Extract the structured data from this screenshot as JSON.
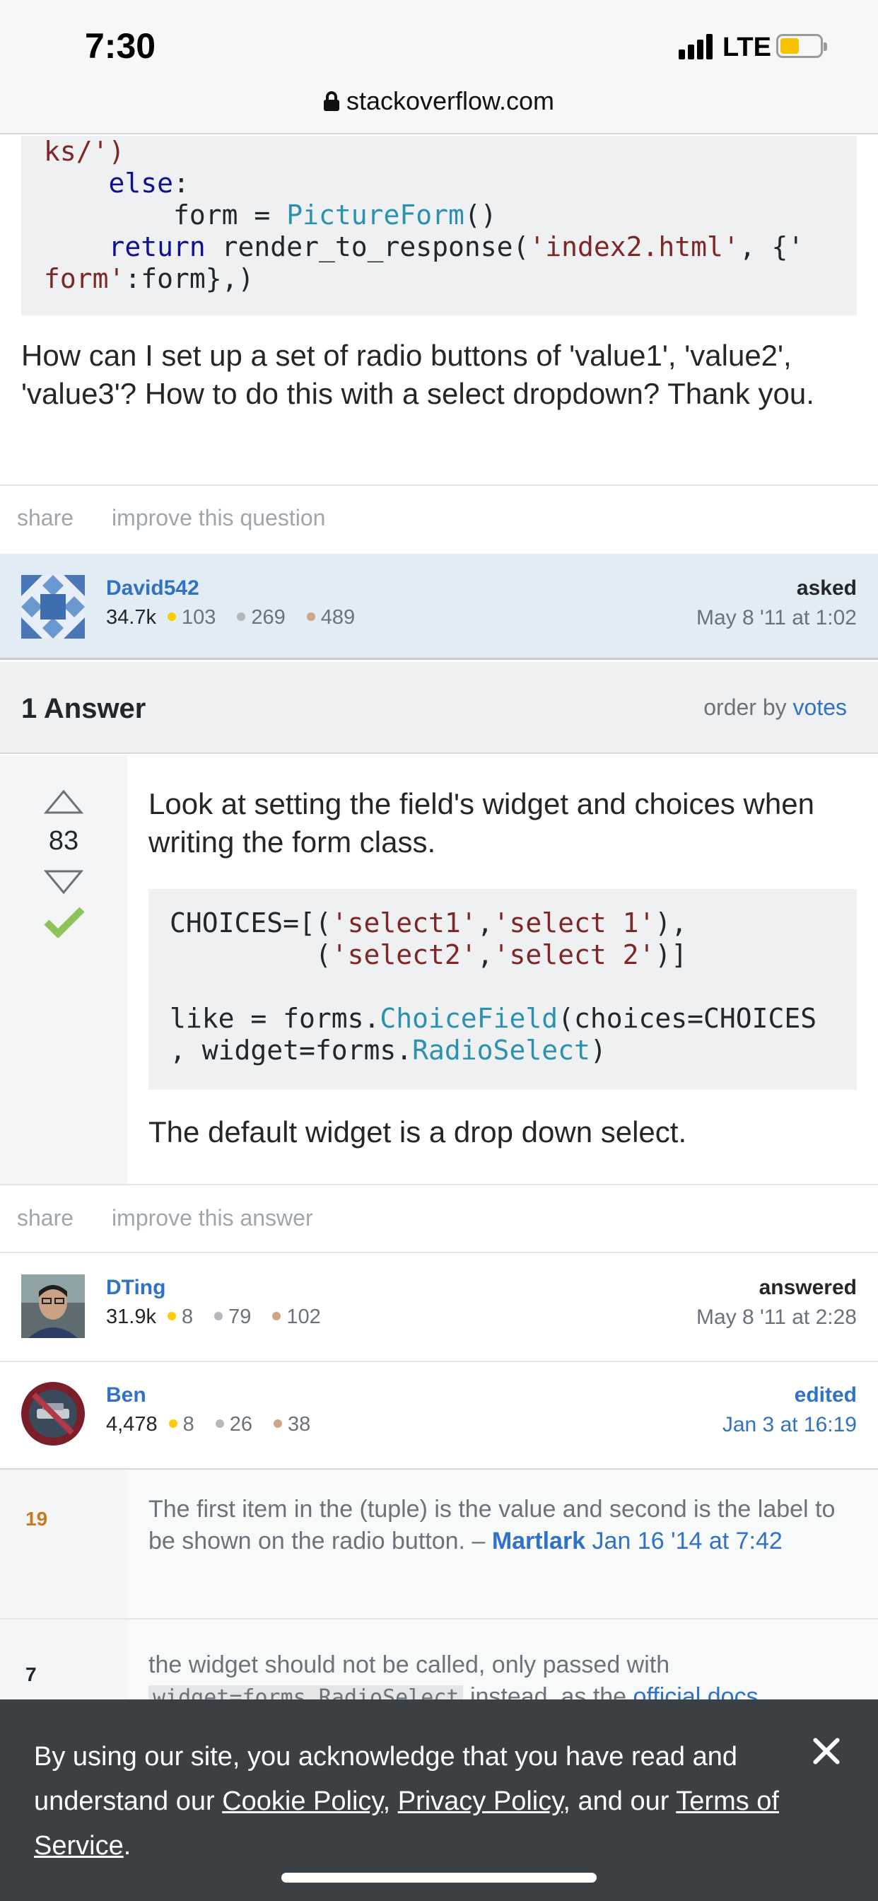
{
  "status_bar": {
    "time": "7:30",
    "network": "LTE"
  },
  "browser": {
    "url": "stackoverflow.com"
  },
  "question": {
    "code_lines": [
      [
        "ks/')",
        ""
      ],
      [
        "    else:",
        ""
      ],
      [
        "        form = PictureForm()",
        ""
      ],
      [
        "    return render_to_response('index2.html', {'",
        ""
      ],
      [
        "form':form},)",
        ""
      ]
    ],
    "code": {
      "l1": "ks/')",
      "l2_kw": "else",
      "l3_a": "form = ",
      "l3_type": "PictureForm",
      "l3_b": "()",
      "l4_kw": "return",
      "l4_a": " render_to_response(",
      "l4_str": "'index2.html'",
      "l4_b": ", {'",
      "l5_str": "form'",
      "l5_b": ":form},)"
    },
    "body": "How can I set up a set of radio buttons of 'value1', 'value2', 'value3'? How to do this with a select dropdown? Thank you.",
    "links": {
      "share": "share",
      "improve": "improve this question"
    },
    "asker": {
      "name": "David542",
      "reputation": "34.7k",
      "gold": "103",
      "silver": "269",
      "bronze": "489",
      "action": "asked",
      "time": "May 8 '11 at 1:02"
    }
  },
  "answers_header": {
    "count_label": "1 Answer",
    "order_prefix": "order by",
    "order_value": "votes"
  },
  "answer": {
    "votes": "83",
    "intro": "Look at setting the field's widget and choices when writing the form class.",
    "code": {
      "l1_a": "CHOICES=[(",
      "l1_s1": "'select1'",
      "l1_c": ",",
      "l1_s2": "'select 1'",
      "l1_e": "),",
      "l2_a": "         (",
      "l2_s1": "'select2'",
      "l2_c": ",",
      "l2_s2": "'select 2'",
      "l2_e": ")]",
      "l4_a": "like = forms.",
      "l4_type": "ChoiceField",
      "l4_b": "(choices=CHOICES",
      "l5_a": ", widget=forms.",
      "l5_type": "RadioSelect",
      "l5_b": ")"
    },
    "outro": "The default widget is a drop down select.",
    "links": {
      "share": "share",
      "improve": "improve this answer"
    },
    "answerer": {
      "name": "DTing",
      "reputation": "31.9k",
      "gold": "8",
      "silver": "79",
      "bronze": "102",
      "action": "answered",
      "time": "May 8 '11 at 2:28"
    },
    "editor": {
      "name": "Ben",
      "reputation": "4,478",
      "gold": "8",
      "silver": "26",
      "bronze": "38",
      "action": "edited",
      "time": "Jan 3 at 16:19"
    }
  },
  "comments": [
    {
      "score": "19",
      "text": "The first item in the (tuple) is the value and second is the label to be shown on the radio button. –",
      "author": "Martlark",
      "time": "Jan 16 '14 at 7:42"
    },
    {
      "score": "7",
      "text_a": "the widget should not be called, only passed with",
      "code": "widget=forms.RadioSelect",
      "text_b": "instead, as the",
      "link": "official docs"
    }
  ],
  "cookie_banner": {
    "text_a": "By using our site, you acknowledge that you have read and understand our",
    "cookie_policy": "Cookie Policy",
    "comma": ",",
    "privacy_policy": "Privacy Policy",
    "text_b": ", and our",
    "terms": "Terms of Service",
    "period": "."
  },
  "colors": {
    "link": "#3172c6",
    "asker_bg": "#e1ecf4",
    "accepted": "#8fc259",
    "comment_score_high": "#c67b1d",
    "banner_bg": "#3b4045"
  }
}
